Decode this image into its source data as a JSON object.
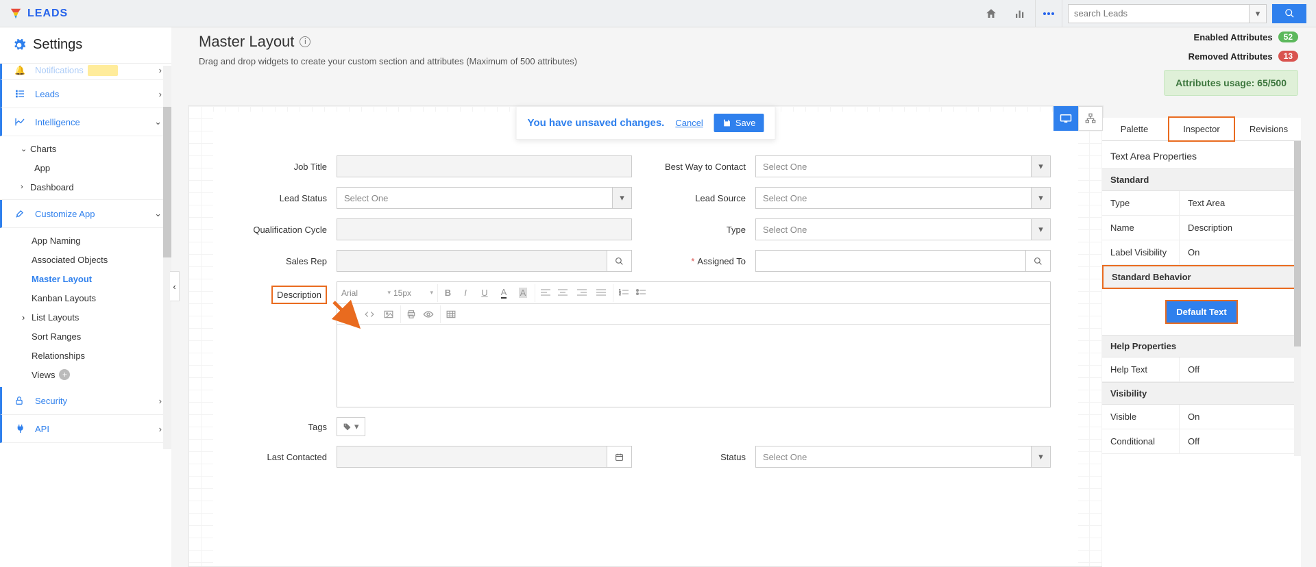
{
  "brand": "LEADS",
  "search_placeholder": "search Leads",
  "settings_title": "Settings",
  "sidebar": {
    "notifications": "Notifications",
    "leads": "Leads",
    "intelligence": "Intelligence",
    "charts": "Charts",
    "app": "App",
    "dashboard": "Dashboard",
    "customize": "Customize App",
    "sub": {
      "app_naming": "App Naming",
      "associated_objects": "Associated Objects",
      "master_layout": "Master Layout",
      "kanban_layouts": "Kanban Layouts",
      "list_layouts": "List Layouts",
      "sort_ranges": "Sort Ranges",
      "relationships": "Relationships",
      "views": "Views"
    },
    "security": "Security",
    "api": "API"
  },
  "page": {
    "title": "Master Layout",
    "subtitle": "Drag and drop widgets to create your custom section and attributes (Maximum of 500 attributes)"
  },
  "stats": {
    "enabled_label": "Enabled Attributes",
    "enabled_count": "52",
    "removed_label": "Removed Attributes",
    "removed_count": "13",
    "usage": "Attributes usage: 65/500"
  },
  "floatbar": {
    "unsaved": "You have unsaved changes.",
    "cancel": "Cancel",
    "save": "Save"
  },
  "form": {
    "job_title": "Job Title",
    "best_way": "Best Way to Contact",
    "lead_status": "Lead Status",
    "lead_source": "Lead Source",
    "qual_cycle": "Qualification Cycle",
    "type": "Type",
    "sales_rep": "Sales Rep",
    "assigned_to": "Assigned To",
    "description": "Description",
    "tags": "Tags",
    "last_contacted": "Last Contacted",
    "status": "Status",
    "select_one": "Select One"
  },
  "rte": {
    "font": "Arial",
    "size": "15px"
  },
  "inspector": {
    "tabs": {
      "palette": "Palette",
      "inspector": "Inspector",
      "revisions": "Revisions"
    },
    "title": "Text Area Properties",
    "standard": "Standard",
    "type_k": "Type",
    "type_v": "Text Area",
    "name_k": "Name",
    "name_v": "Description",
    "labelvis_k": "Label Visibility",
    "labelvis_v": "On",
    "behavior": "Standard Behavior",
    "default_text": "Default Text",
    "help_props": "Help Properties",
    "helptext_k": "Help Text",
    "helptext_v": "Off",
    "visibility": "Visibility",
    "visible_k": "Visible",
    "visible_v": "On",
    "conditional_k": "Conditional",
    "conditional_v": "Off"
  }
}
